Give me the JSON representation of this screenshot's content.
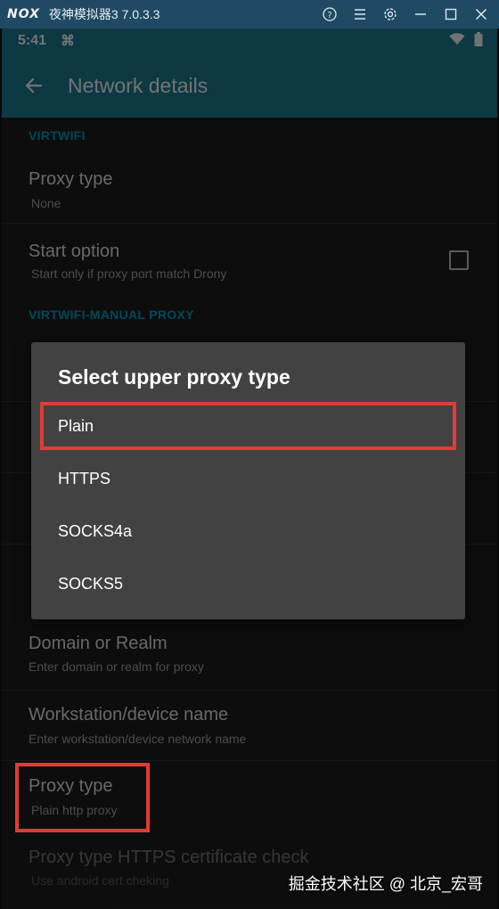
{
  "emulator": {
    "logo": "NOX",
    "title": "夜神模拟器3 7.0.3.3",
    "controls": [
      "help-icon",
      "menu-icon",
      "settings-icon",
      "minimize-icon",
      "maximize-icon",
      "close-icon"
    ]
  },
  "status_bar": {
    "time": "5:41",
    "cmd_glyph": "⌘"
  },
  "app_bar": {
    "title": "Network details"
  },
  "sections": {
    "virtwifi": "VIRTWIFI",
    "manual_proxy": "VIRTWIFI-MANUAL PROXY"
  },
  "prefs": {
    "proxy_type_top": {
      "title": "Proxy type",
      "summary": "None"
    },
    "start_option": {
      "title": "Start option",
      "summary": "Start only if proxy port match Drony"
    },
    "domain": {
      "title": "Domain or Realm",
      "summary": "Enter domain or realm for proxy"
    },
    "workstation": {
      "title": "Workstation/device name",
      "summary": "Enter workstation/device network name"
    },
    "proxy_type_bottom": {
      "title": "Proxy type",
      "summary": "Plain http proxy"
    },
    "https_check": {
      "title": "Proxy type HTTPS certificate check",
      "summary": "Use android cert cheking"
    }
  },
  "dialog": {
    "title": "Select upper proxy type",
    "options": [
      "Plain",
      "HTTPS",
      "SOCKS4a",
      "SOCKS5"
    ]
  },
  "colors": {
    "accent": "#1b7e96",
    "section": "#00a0cd",
    "highlight": "#e53935"
  },
  "watermark": "掘金技术社区 @ 北京_宏哥"
}
